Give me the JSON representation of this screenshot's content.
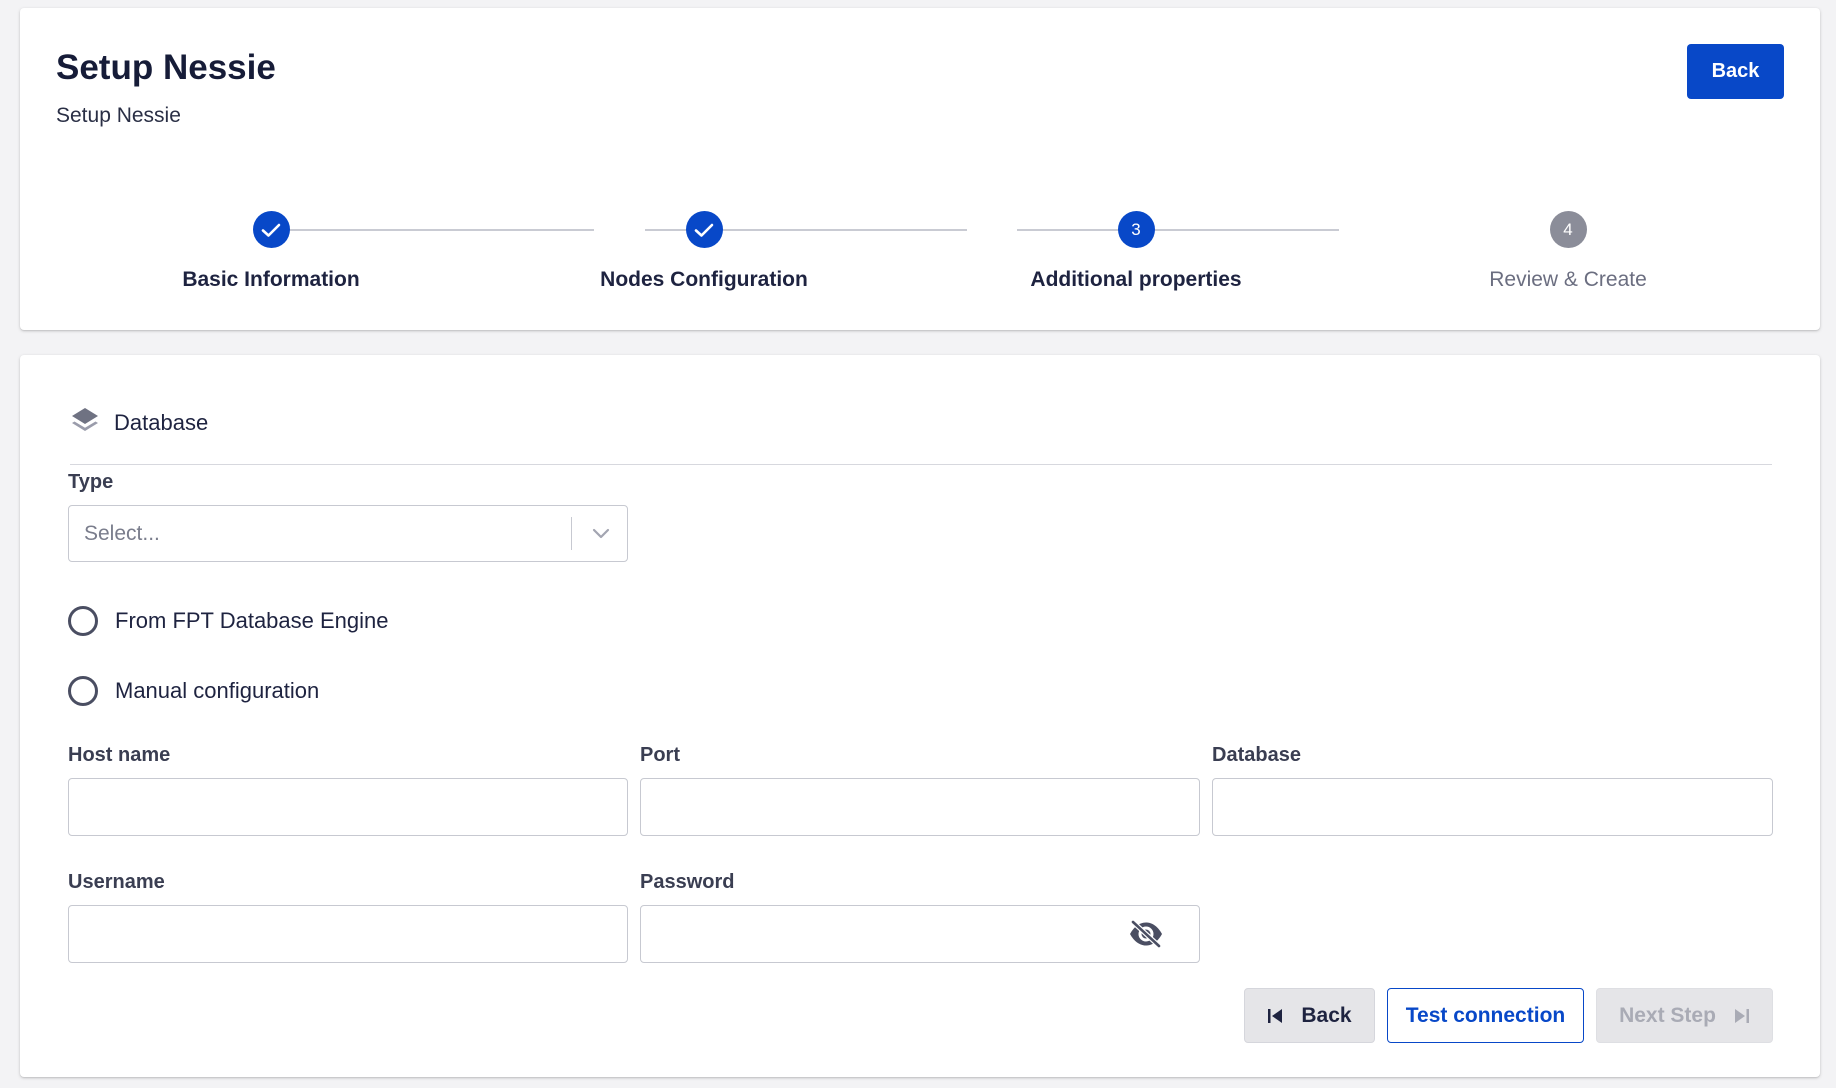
{
  "header": {
    "title": "Setup Nessie",
    "subtitle": "Setup Nessie",
    "back_label": "Back"
  },
  "stepper": {
    "steps": [
      {
        "label": "Basic Information",
        "status": "completed",
        "number": "1"
      },
      {
        "label": "Nodes Configuration",
        "status": "completed",
        "number": "2"
      },
      {
        "label": "Additional properties",
        "status": "active",
        "number": "3"
      },
      {
        "label": "Review & Create",
        "status": "pending",
        "number": "4"
      }
    ]
  },
  "section": {
    "icon": "layers-icon",
    "title": "Database"
  },
  "type_field": {
    "label": "Type",
    "placeholder": "Select..."
  },
  "radios": {
    "fpt_engine": "From FPT Database Engine",
    "manual": "Manual configuration"
  },
  "fields": {
    "host_name": {
      "label": "Host name",
      "value": ""
    },
    "port": {
      "label": "Port",
      "value": ""
    },
    "database": {
      "label": "Database",
      "value": ""
    },
    "username": {
      "label": "Username",
      "value": ""
    },
    "password": {
      "label": "Password",
      "value": ""
    }
  },
  "actions": {
    "back_label": "Back",
    "test_label": "Test connection",
    "next_label": "Next Step"
  },
  "colors": {
    "primary": "#0848c8",
    "pending_step": "#8b8d99",
    "disabled_text": "#a9abb5"
  }
}
